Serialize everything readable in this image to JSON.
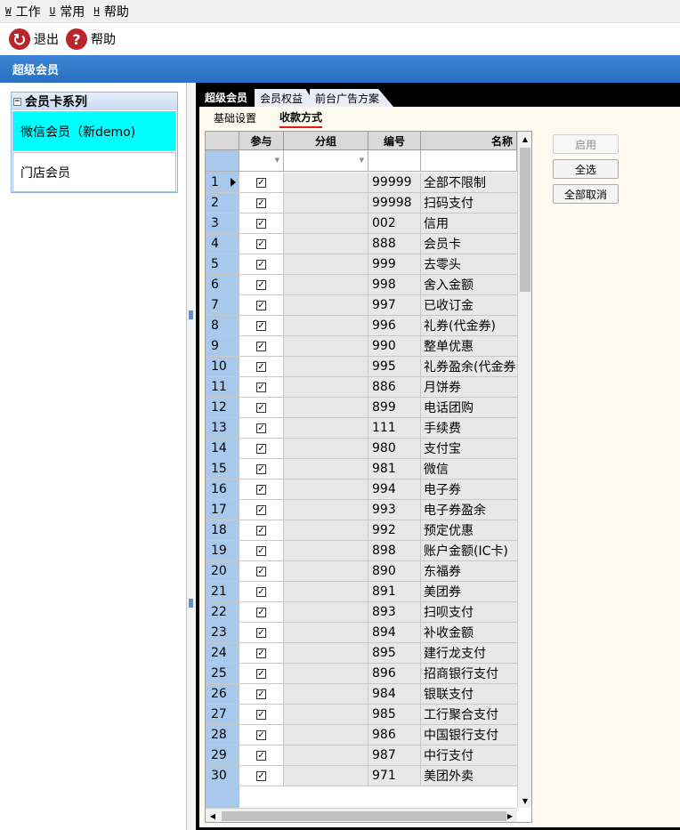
{
  "menubar": {
    "items": [
      {
        "key": "W",
        "label": "工作"
      },
      {
        "key": "U",
        "label": "常用"
      },
      {
        "key": "H",
        "label": "帮助"
      }
    ]
  },
  "toolbar": {
    "exit_label": "退出",
    "help_label": "帮助",
    "exit_icon": "exit-icon",
    "help_icon": "help-icon"
  },
  "header": {
    "title": "超级会员"
  },
  "left": {
    "series_title": "会员卡系列",
    "collapse_glyph": "−",
    "cards": [
      "微信会员（新demo)",
      "门店会员"
    ]
  },
  "tabs": [
    "超级会员",
    "会员权益",
    "前台广告方案"
  ],
  "subtabs": [
    "基础设置",
    "收款方式"
  ],
  "grid": {
    "columns": [
      "参与",
      "分组",
      "编号",
      "名称"
    ],
    "check_glyph": "✓",
    "rows": [
      {
        "n": "1",
        "code": "99999",
        "name": "全部不限制"
      },
      {
        "n": "2",
        "code": "99998",
        "name": "扫码支付"
      },
      {
        "n": "3",
        "code": "002",
        "name": "信用"
      },
      {
        "n": "4",
        "code": "888",
        "name": "会员卡"
      },
      {
        "n": "5",
        "code": "999",
        "name": "去零头"
      },
      {
        "n": "6",
        "code": "998",
        "name": "舍入金额"
      },
      {
        "n": "7",
        "code": "997",
        "name": "已收订金"
      },
      {
        "n": "8",
        "code": "996",
        "name": "礼券(代金券)"
      },
      {
        "n": "9",
        "code": "990",
        "name": "整单优惠"
      },
      {
        "n": "10",
        "code": "995",
        "name": "礼券盈余(代金券"
      },
      {
        "n": "11",
        "code": "886",
        "name": "月饼券"
      },
      {
        "n": "12",
        "code": "899",
        "name": "电话团购"
      },
      {
        "n": "13",
        "code": "111",
        "name": "手续费"
      },
      {
        "n": "14",
        "code": "980",
        "name": "支付宝"
      },
      {
        "n": "15",
        "code": "981",
        "name": "微信"
      },
      {
        "n": "16",
        "code": "994",
        "name": "电子券"
      },
      {
        "n": "17",
        "code": "993",
        "name": "电子券盈余"
      },
      {
        "n": "18",
        "code": "992",
        "name": "预定优惠"
      },
      {
        "n": "19",
        "code": "898",
        "name": "账户金额(IC卡)"
      },
      {
        "n": "20",
        "code": "890",
        "name": "东福券"
      },
      {
        "n": "21",
        "code": "891",
        "name": "美团券"
      },
      {
        "n": "22",
        "code": "893",
        "name": "扫呗支付"
      },
      {
        "n": "23",
        "code": "894",
        "name": "补收金额"
      },
      {
        "n": "24",
        "code": "895",
        "name": "建行龙支付"
      },
      {
        "n": "25",
        "code": "896",
        "name": "招商银行支付"
      },
      {
        "n": "26",
        "code": "984",
        "name": "银联支付"
      },
      {
        "n": "27",
        "code": "985",
        "name": "工行聚合支付"
      },
      {
        "n": "28",
        "code": "986",
        "name": "中国银行支付"
      },
      {
        "n": "29",
        "code": "987",
        "name": "中行支付"
      },
      {
        "n": "30",
        "code": "971",
        "name": "美团外卖"
      }
    ]
  },
  "actions": {
    "enable_label": "启用",
    "select_all_label": "全选",
    "deselect_all_label": "全部取消"
  }
}
